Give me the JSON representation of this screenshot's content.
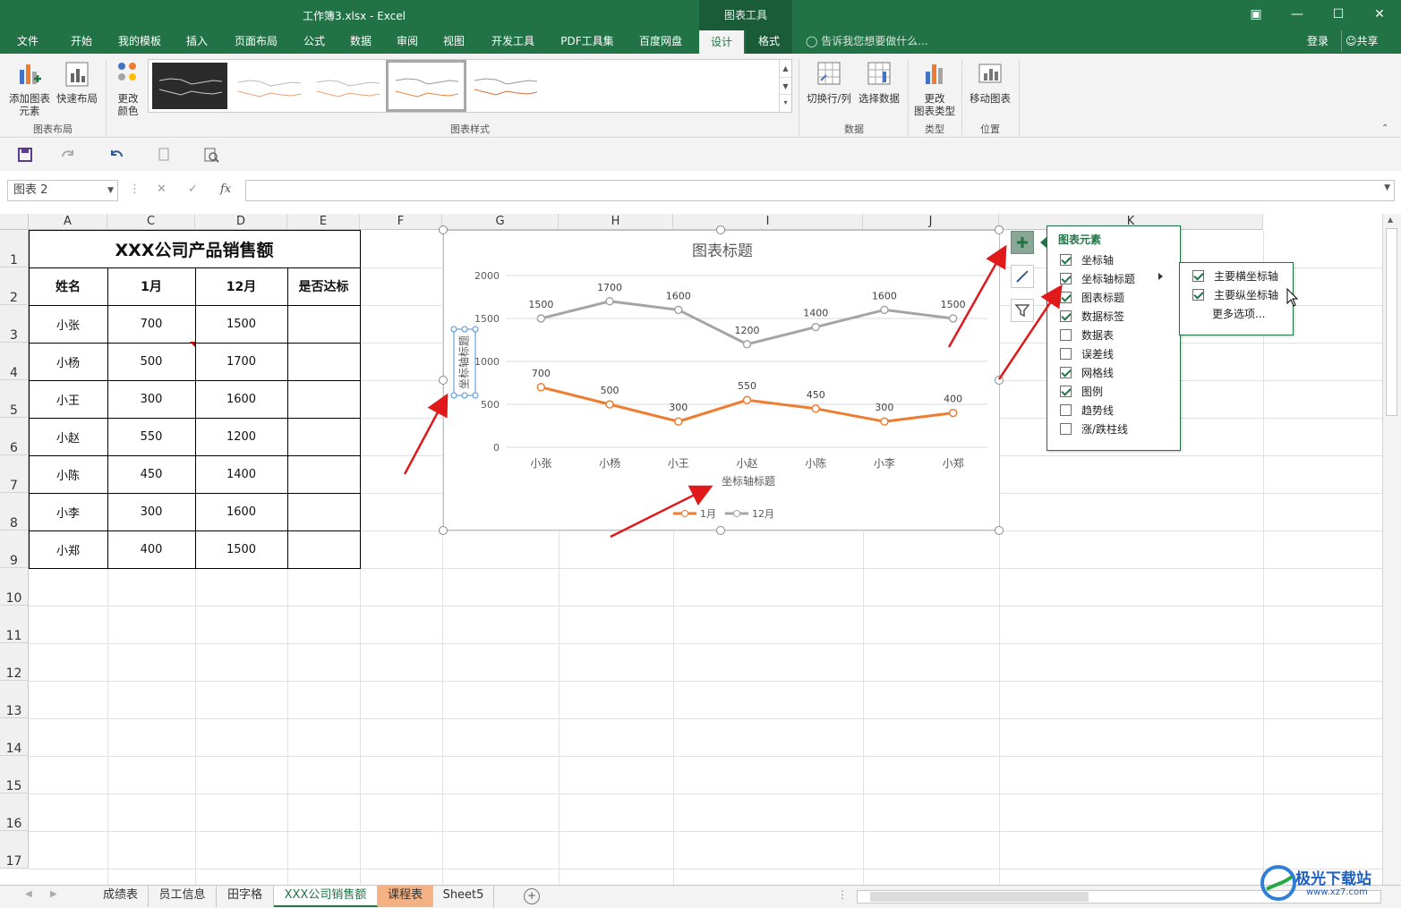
{
  "window": {
    "title": "工作簿3.xlsx - Excel",
    "context_title": "图表工具"
  },
  "tabs": [
    "文件",
    "开始",
    "我的模板",
    "插入",
    "页面布局",
    "公式",
    "数据",
    "审阅",
    "视图",
    "开发工具",
    "PDF工具集",
    "百度网盘",
    "设计",
    "格式"
  ],
  "active_tab": "设计",
  "tell_me": "告诉我您想要做什么...",
  "account": {
    "login": "登录",
    "share": "共享"
  },
  "ribbon": {
    "add_element": [
      "添加图表",
      "元素"
    ],
    "quick_layout": "快速布局",
    "change_colors": [
      "更改",
      "颜色"
    ],
    "group_layout": "图表布局",
    "group_styles": "图表样式",
    "switch_row_col": "切换行/列",
    "select_data": "选择数据",
    "group_data": "数据",
    "change_type": [
      "更改",
      "图表类型"
    ],
    "group_type": "类型",
    "move_chart": "移动图表",
    "group_location": "位置"
  },
  "namebox": "图表 2",
  "columns": [
    "A",
    "C",
    "D",
    "E",
    "F",
    "G",
    "H",
    "I",
    "J",
    "K"
  ],
  "rows": [
    "1",
    "2",
    "3",
    "4",
    "5",
    "6",
    "7",
    "8",
    "9",
    "10",
    "11",
    "12",
    "13",
    "14",
    "15",
    "16",
    "17"
  ],
  "table": {
    "title": "XXX公司产品销售额",
    "headers": [
      "姓名",
      "1月",
      "12月",
      "是否达标"
    ],
    "rows": [
      [
        "小张",
        "700",
        "1500",
        ""
      ],
      [
        "小杨",
        "500",
        "1700",
        ""
      ],
      [
        "小王",
        "300",
        "1600",
        ""
      ],
      [
        "小赵",
        "550",
        "1200",
        ""
      ],
      [
        "小陈",
        "450",
        "1400",
        ""
      ],
      [
        "小李",
        "300",
        "1600",
        ""
      ],
      [
        "小郑",
        "400",
        "1500",
        ""
      ]
    ]
  },
  "chart_data": {
    "type": "line",
    "title": "图表标题",
    "xlabel": "坐标轴标题",
    "ylabel": "坐标轴标题",
    "categories": [
      "小张",
      "小杨",
      "小王",
      "小赵",
      "小陈",
      "小李",
      "小郑"
    ],
    "ylim": [
      0,
      2000
    ],
    "yticks": [
      "0",
      "500",
      "1000",
      "1500",
      "2000"
    ],
    "grid": true,
    "legend": "bottom",
    "series": [
      {
        "name": "1月",
        "values": [
          700,
          500,
          300,
          550,
          450,
          300,
          400
        ],
        "color": "#ED7D31"
      },
      {
        "name": "12月",
        "values": [
          1500,
          1700,
          1600,
          1200,
          1400,
          1600,
          1500
        ],
        "color": "#A5A5A5"
      }
    ]
  },
  "chart_elements": {
    "header": "图表元素",
    "items": [
      {
        "label": "坐标轴",
        "checked": true
      },
      {
        "label": "坐标轴标题",
        "checked": true
      },
      {
        "label": "图表标题",
        "checked": true
      },
      {
        "label": "数据标签",
        "checked": true
      },
      {
        "label": "数据表",
        "checked": false
      },
      {
        "label": "误差线",
        "checked": false
      },
      {
        "label": "网格线",
        "checked": true
      },
      {
        "label": "图例",
        "checked": true
      },
      {
        "label": "趋势线",
        "checked": false
      },
      {
        "label": "涨/跌柱线",
        "checked": false
      }
    ],
    "submenu": [
      {
        "label": "主要横坐标轴",
        "checked": true
      },
      {
        "label": "主要纵坐标轴",
        "checked": true
      }
    ],
    "more": "更多选项..."
  },
  "sheets": [
    "成绩表",
    "员工信息",
    "田字格",
    "XXX公司销售额",
    "课程表",
    "Sheet5"
  ],
  "active_sheet": "XXX公司销售额",
  "watermark": "极光下载站",
  "watermark_url": "www.xz7.com"
}
